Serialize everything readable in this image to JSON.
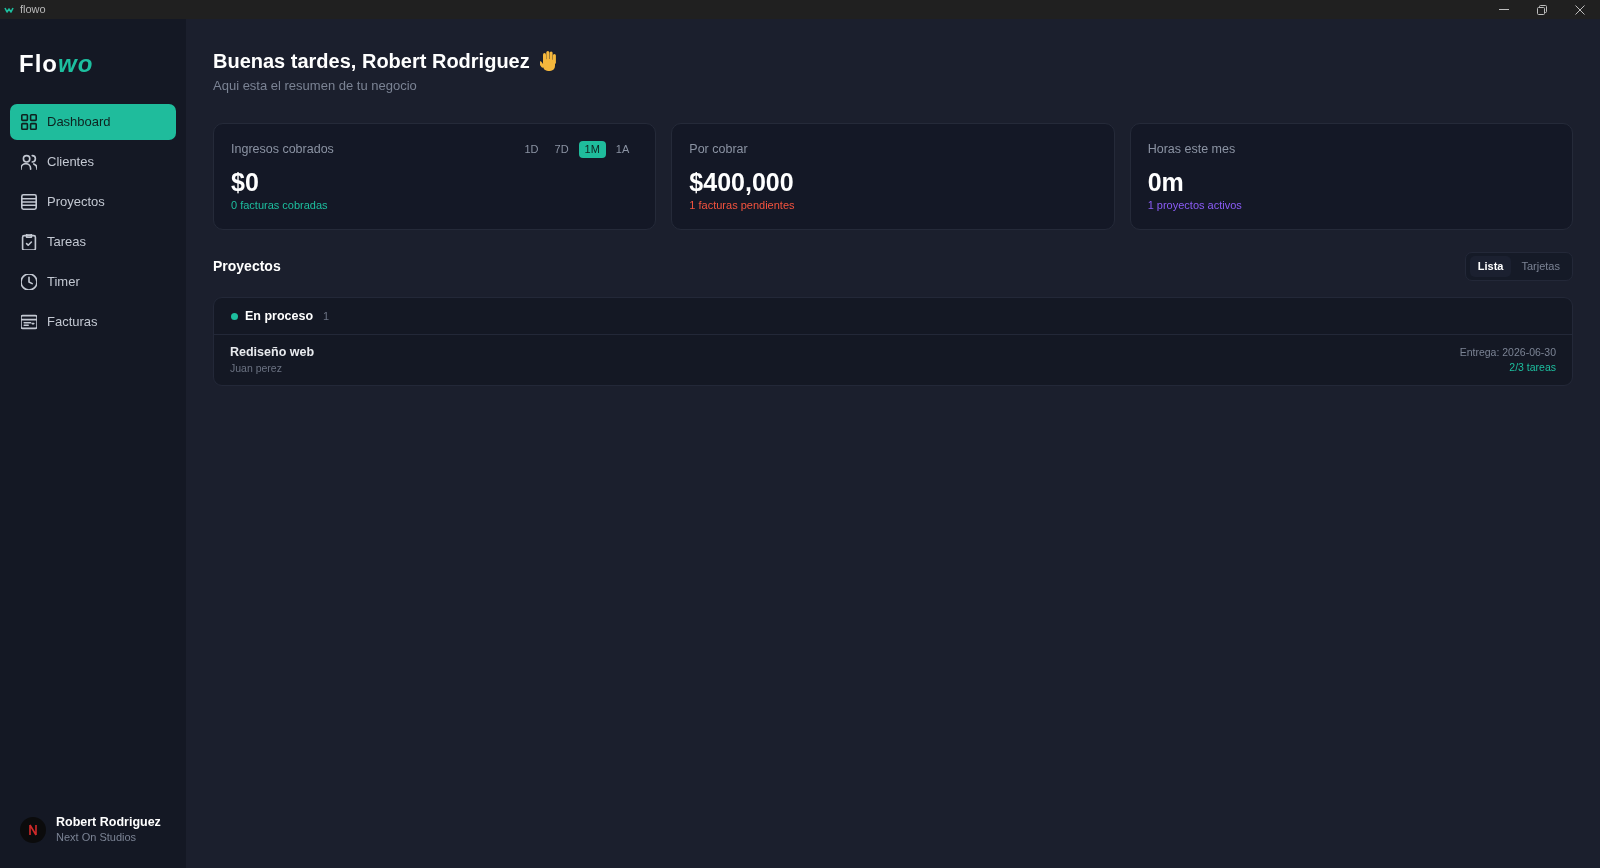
{
  "window": {
    "title": "flowo"
  },
  "sidebar": {
    "logo": {
      "main": "Flo",
      "accent": "wo"
    },
    "items": [
      {
        "label": "Dashboard",
        "selected": true
      },
      {
        "label": "Clientes",
        "selected": false
      },
      {
        "label": "Proyectos",
        "selected": false
      },
      {
        "label": "Tareas",
        "selected": false
      },
      {
        "label": "Timer",
        "selected": false
      },
      {
        "label": "Facturas",
        "selected": false
      }
    ],
    "user": {
      "name": "Robert Rodriguez",
      "company": "Next On Studios"
    }
  },
  "header": {
    "greeting": "Buenas tardes, Robert Rodriguez",
    "subtitle": "Aqui esta el resumen de tu negocio"
  },
  "stats": [
    {
      "label": "Ingresos cobrados",
      "value": "$0",
      "note": "0 facturas cobradas",
      "color": "#1dbf9f",
      "periods": [
        {
          "label": "1D",
          "selected": false
        },
        {
          "label": "7D",
          "selected": false
        },
        {
          "label": "1M",
          "selected": true
        },
        {
          "label": "1A",
          "selected": false
        }
      ]
    },
    {
      "label": "Por cobrar",
      "value": "$400,000",
      "note": "1 facturas pendientes",
      "color": "#f4533e"
    },
    {
      "label": "Horas este mes",
      "value": "0m",
      "note": "1 proyectos activos",
      "color": "#8b5cf6"
    }
  ],
  "projects": {
    "title": "Proyectos",
    "views": [
      {
        "label": "Lista",
        "selected": true
      },
      {
        "label": "Tarjetas",
        "selected": false
      }
    ],
    "groups": [
      {
        "name": "En proceso",
        "count": "1",
        "color": "#1dbf9f",
        "items": [
          {
            "name": "Rediseño web",
            "client": "Juan perez",
            "due": "Entrega: 2026-06-30",
            "tasks": "2/3 tareas"
          }
        ]
      }
    ]
  }
}
